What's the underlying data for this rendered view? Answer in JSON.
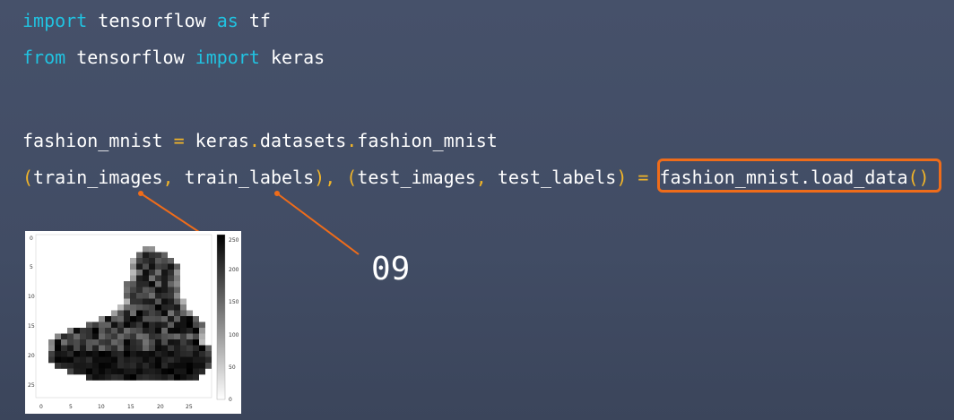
{
  "code": {
    "line1": {
      "kw1": "import",
      "mod": " tensorflow ",
      "kw2": "as",
      "alias": " tf"
    },
    "line2": {
      "kw1": "from",
      "mod": " tensorflow ",
      "kw2": "import",
      "name": " keras"
    },
    "line3": {
      "lhs": "fashion_mnist ",
      "eq": "=",
      "rhs": " keras",
      "dot1": ".",
      "ds": "datasets",
      "dot2": ".",
      "fm": "fashion_mnist"
    },
    "line4": {
      "p1": "(",
      "train_images": "train_images",
      "c1": ",",
      "sp1": " ",
      "train_labels": "train_labels",
      "p2": ")",
      "c2": ",",
      "sp2": " ",
      "p3": "(",
      "test_images": "test_images",
      "c3": ",",
      "sp3": " ",
      "test_labels": "test_labels",
      "p4": ")",
      "sp4": " ",
      "eq": "=",
      "sp5": " ",
      "call_obj": "fashion_mnist",
      "call_dot": ".",
      "call_fn": "load_data",
      "call_parens": "()"
    }
  },
  "annotation": {
    "label": "09"
  },
  "image_plot": {
    "y_ticks": [
      "0",
      "5",
      "10",
      "15",
      "20",
      "25"
    ],
    "x_ticks": [
      "0",
      "5",
      "10",
      "15",
      "20",
      "25"
    ],
    "colorbar_ticks": [
      "250",
      "200",
      "150",
      "100",
      "50",
      "0"
    ]
  },
  "colors": {
    "keyword": "#21c2e0",
    "operator": "#f0b429",
    "highlight": "#ef6c1a"
  }
}
